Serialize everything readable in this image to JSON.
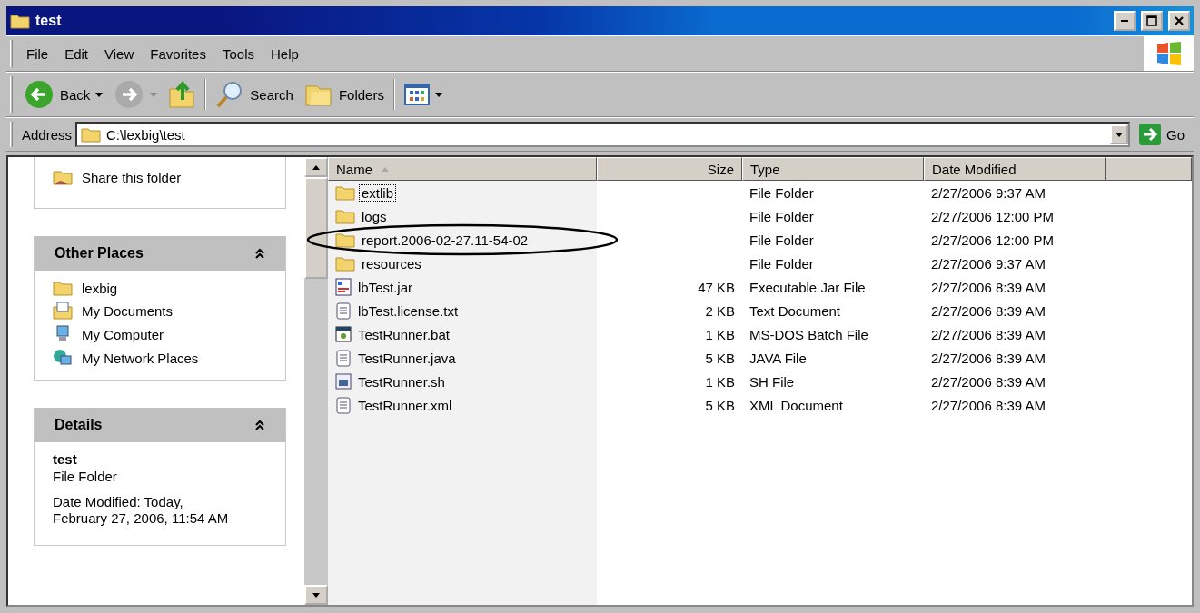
{
  "window": {
    "title": "test"
  },
  "menu": [
    "File",
    "Edit",
    "View",
    "Favorites",
    "Tools",
    "Help"
  ],
  "toolbar": {
    "back": "Back",
    "search": "Search",
    "folders": "Folders"
  },
  "address": {
    "label": "Address",
    "value": "C:\\lexbig\\test",
    "go": "Go"
  },
  "sidebar": {
    "tasks": [
      {
        "label": "Share this folder"
      }
    ],
    "other_places": {
      "title": "Other Places",
      "expanded": true,
      "items": [
        {
          "label": "lexbig",
          "kind": "folder"
        },
        {
          "label": "My Documents",
          "kind": "documents"
        },
        {
          "label": "My Computer",
          "kind": "computer"
        },
        {
          "label": "My Network Places",
          "kind": "network"
        }
      ]
    },
    "details": {
      "title": "Details",
      "expanded": true,
      "name": "test",
      "type": "File Folder",
      "modified": "Date Modified: Today, February 27, 2006, 11:54 AM"
    }
  },
  "table": {
    "columns": [
      {
        "label": "Name",
        "sorted": true
      },
      {
        "label": "Size",
        "sorted": false
      },
      {
        "label": "Type",
        "sorted": false
      },
      {
        "label": "Date Modified",
        "sorted": false
      }
    ],
    "rows": [
      {
        "name": "extlib",
        "kind": "folder",
        "type": "File Folder",
        "date": "2/27/2006 9:37 AM",
        "focused": true,
        "circled": false
      },
      {
        "name": "logs",
        "kind": "folder",
        "type": "File Folder",
        "date": "2/27/2006 12:00 PM",
        "focused": false,
        "circled": false
      },
      {
        "name": "report.2006-02-27.11-54-02",
        "kind": "folder",
        "type": "File Folder",
        "date": "2/27/2006 12:00 PM",
        "focused": false,
        "circled": true
      },
      {
        "name": "resources",
        "kind": "folder",
        "type": "File Folder",
        "date": "2/27/2006 9:37 AM",
        "focused": false,
        "circled": false
      },
      {
        "name": "lbTest.jar",
        "kind": "jar",
        "size": "47 KB",
        "type": "Executable Jar File",
        "date": "2/27/2006 8:39 AM",
        "focused": false,
        "circled": false
      },
      {
        "name": "lbTest.license.txt",
        "kind": "text",
        "size": "2 KB",
        "type": "Text Document",
        "date": "2/27/2006 8:39 AM",
        "focused": false,
        "circled": false
      },
      {
        "name": "TestRunner.bat",
        "kind": "batch",
        "size": "1 KB",
        "type": "MS-DOS Batch File",
        "date": "2/27/2006 8:39 AM",
        "focused": false,
        "circled": false
      },
      {
        "name": "TestRunner.java",
        "kind": "text",
        "size": "5 KB",
        "type": "JAVA File",
        "date": "2/27/2006 8:39 AM",
        "focused": false,
        "circled": false
      },
      {
        "name": "TestRunner.sh",
        "kind": "script",
        "size": "1 KB",
        "type": "SH File",
        "date": "2/27/2006 8:39 AM",
        "focused": false,
        "circled": false
      },
      {
        "name": "TestRunner.xml",
        "kind": "text",
        "size": "5 KB",
        "type": "XML Document",
        "date": "2/27/2006 8:39 AM",
        "focused": false,
        "circled": false
      }
    ]
  }
}
